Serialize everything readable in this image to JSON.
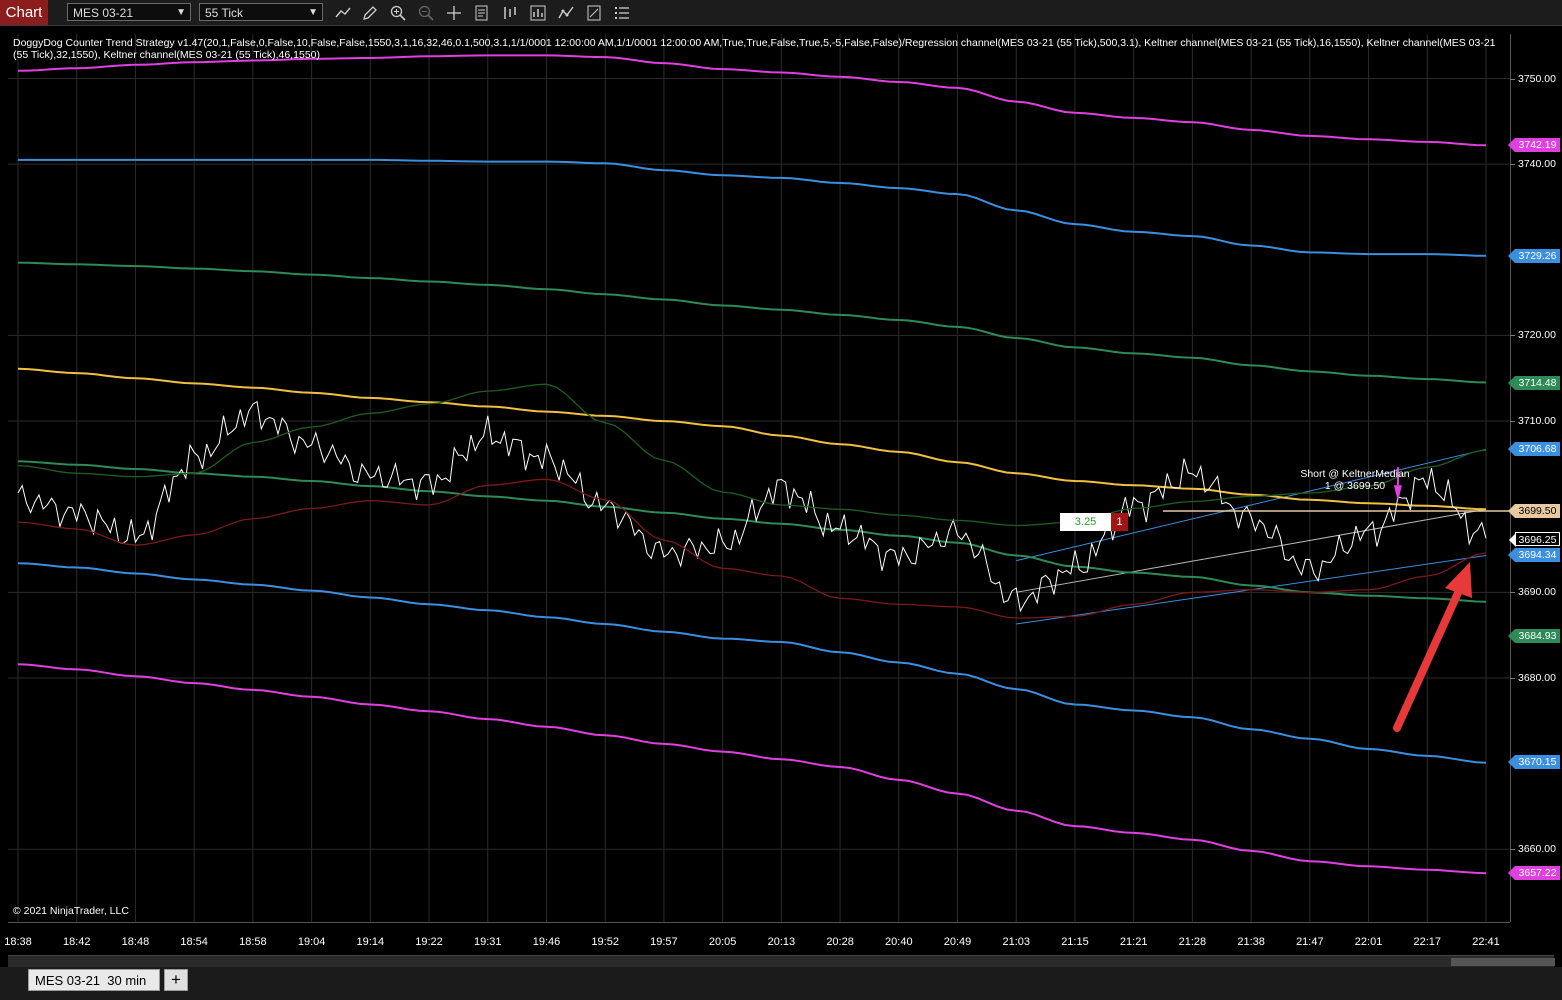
{
  "toolbar": {
    "chart_tab": "Chart",
    "instrument": "MES 03-21",
    "interval": "55 Tick",
    "icons": [
      "line-chart-icon",
      "pencil-icon",
      "zoom-in-icon",
      "zoom-out-icon",
      "crosshair-icon",
      "properties-icon",
      "data-series-icon",
      "indicators-icon",
      "strategies-icon",
      "templates-icon",
      "list-icon"
    ]
  },
  "legend": "DoggyDog Counter Trend Strategy v1.47(20,1,False,0,False,10,False,False,1550,3,1,16,32,46,0.1,500,3.1,1/1/0001 12:00:00 AM,1/1/0001 12:00:00 AM,True,True,False,True,5,-5,False,False)/Regression channel(MES 03-21 (55 Tick),500,3.1), Keltner channel(MES 03-21 (55 Tick),16,1550), Keltner channel(MES 03-21 (55 Tick),32,1550), Keltner channel(MES 03-21 (55 Tick),46,1550)",
  "copyright": "© 2021 NinjaTrader, LLC",
  "x_ticks": [
    "18:38",
    "18:42",
    "18:48",
    "18:54",
    "18:58",
    "19:04",
    "19:14",
    "19:22",
    "19:31",
    "19:46",
    "19:52",
    "19:57",
    "20:05",
    "20:13",
    "20:28",
    "20:40",
    "20:49",
    "21:03",
    "21:15",
    "21:21",
    "21:28",
    "21:38",
    "21:47",
    "22:01",
    "22:17",
    "22:41"
  ],
  "y_ticks": [
    "3750.00",
    "3740.00",
    "3720.00",
    "3710.00",
    "3690.00",
    "3680.00",
    "3660.00"
  ],
  "price_labels": [
    {
      "value": "3742.19",
      "color": "#e040e0"
    },
    {
      "value": "3729.26",
      "color": "#3a8fe0"
    },
    {
      "value": "3714.48",
      "color": "#2e8b57"
    },
    {
      "value": "3706.68",
      "color": "#3a8fe0"
    },
    {
      "value": "3699.50",
      "color": "#e8c9a0"
    },
    {
      "value": "3696.25",
      "color": "#000000"
    },
    {
      "value": "3694.34",
      "color": "#3a8fe0"
    },
    {
      "value": "3684.93",
      "color": "#2e8b57"
    },
    {
      "value": "3670.15",
      "color": "#3a8fe0"
    },
    {
      "value": "3657.22",
      "color": "#e040e0"
    }
  ],
  "trade": {
    "pnl": "3.25",
    "qty": "1",
    "label_line1": "Short @ KeltnerMedian",
    "label_line2": "1 @ 3699.50"
  },
  "bottom": {
    "tab": "MES 03-21  30 min",
    "add": "+"
  },
  "chart_data": {
    "type": "line",
    "title": "",
    "x": [
      "18:38",
      "18:42",
      "18:48",
      "18:54",
      "18:58",
      "19:04",
      "19:14",
      "19:22",
      "19:31",
      "19:46",
      "19:52",
      "19:57",
      "20:05",
      "20:13",
      "20:28",
      "20:40",
      "20:49",
      "21:03",
      "21:15",
      "21:21",
      "21:28",
      "21:38",
      "21:47",
      "22:01",
      "22:17",
      "22:41"
    ],
    "ylim": [
      3651.5,
      3755.2
    ],
    "series": [
      {
        "role": "outer-upper",
        "color": "#e040e0",
        "values": [
          3750.9,
          3751.2,
          3751.6,
          3751.9,
          3752.1,
          3752.3,
          3752.4,
          3752.6,
          3752.7,
          3752.7,
          3752.5,
          3751.8,
          3751.1,
          3750.7,
          3750.2,
          3749.6,
          3748.9,
          3747.3,
          3746.0,
          3745.4,
          3744.9,
          3744.0,
          3743.3,
          3742.9,
          3742.6,
          3742.2
        ]
      },
      {
        "role": "mid-upper",
        "color": "#3a8fe0",
        "values": [
          3740.5,
          3740.5,
          3740.5,
          3740.5,
          3740.5,
          3740.5,
          3740.5,
          3740.4,
          3740.3,
          3740.3,
          3740.1,
          3739.3,
          3738.7,
          3738.4,
          3737.8,
          3737.2,
          3736.5,
          3734.6,
          3733.0,
          3732.1,
          3731.6,
          3730.5,
          3729.7,
          3729.5,
          3729.5,
          3729.3
        ]
      },
      {
        "role": "inner-upper",
        "color": "#2e8b57",
        "values": [
          3728.5,
          3728.3,
          3728.1,
          3727.8,
          3727.5,
          3727.1,
          3726.7,
          3726.3,
          3725.9,
          3725.4,
          3724.8,
          3724.2,
          3723.5,
          3723.0,
          3722.4,
          3721.8,
          3721.0,
          3719.7,
          3718.6,
          3717.9,
          3717.4,
          3716.5,
          3715.8,
          3715.3,
          3714.9,
          3714.5
        ]
      },
      {
        "role": "regression-mid",
        "color": "#f0c040",
        "values": [
          3716.1,
          3715.6,
          3715.0,
          3714.4,
          3713.9,
          3713.3,
          3712.7,
          3712.2,
          3711.7,
          3711.1,
          3710.6,
          3710.0,
          3709.4,
          3708.3,
          3707.3,
          3706.4,
          3705.2,
          3703.9,
          3703.0,
          3702.5,
          3702.1,
          3701.4,
          3700.8,
          3700.4,
          3700.1,
          3699.7
        ]
      },
      {
        "role": "inner-lower",
        "color": "#2e8b57",
        "values": [
          3705.3,
          3704.9,
          3704.4,
          3703.9,
          3703.5,
          3703.0,
          3702.4,
          3701.8,
          3701.2,
          3700.7,
          3700.0,
          3699.3,
          3698.6,
          3698.0,
          3697.3,
          3696.6,
          3695.8,
          3694.3,
          3693.0,
          3692.3,
          3691.8,
          3690.8,
          3690.0,
          3689.6,
          3689.3,
          3688.9
        ]
      },
      {
        "role": "mid-lower",
        "color": "#3a8fe0",
        "values": [
          3693.4,
          3692.9,
          3692.2,
          3691.5,
          3690.9,
          3690.2,
          3689.4,
          3688.6,
          3687.9,
          3687.1,
          3686.3,
          3685.4,
          3684.6,
          3684.2,
          3683.0,
          3681.8,
          3680.5,
          3678.7,
          3676.9,
          3676.2,
          3675.4,
          3674.0,
          3672.9,
          3671.7,
          3670.9,
          3670.1
        ]
      },
      {
        "role": "outer-lower",
        "color": "#e040e0",
        "values": [
          3681.6,
          3681.0,
          3680.2,
          3679.4,
          3678.6,
          3677.8,
          3676.9,
          3676.1,
          3675.2,
          3674.3,
          3673.3,
          3672.3,
          3671.4,
          3670.5,
          3669.6,
          3668.1,
          3666.5,
          3664.5,
          3662.7,
          3661.9,
          3661.1,
          3659.8,
          3658.6,
          3658.0,
          3657.6,
          3657.2
        ]
      },
      {
        "role": "price",
        "color": "#ffffff",
        "values": [
          3701.0,
          3699.2,
          3696.4,
          3705.6,
          3711.0,
          3707.2,
          3703.6,
          3702.7,
          3708.3,
          3705.5,
          3700.0,
          3694.6,
          3695.5,
          3702.2,
          3697.3,
          3694.1,
          3696.9,
          3689.0,
          3692.8,
          3700.1,
          3703.9,
          3698.5,
          3692.6,
          3697.0,
          3703.0,
          3696.3
        ]
      },
      {
        "role": "ma-dark-green",
        "color": "#1f5e1f",
        "values": [
          3704.8,
          3703.9,
          3703.5,
          3703.9,
          3707.5,
          3709.3,
          3710.9,
          3712.0,
          3713.5,
          3714.3,
          3709.8,
          3705.4,
          3701.7,
          3700.2,
          3699.7,
          3699.0,
          3698.4,
          3697.8,
          3698.2,
          3699.8,
          3700.6,
          3701.2,
          3701.6,
          3702.4,
          3704.6,
          3706.6
        ]
      },
      {
        "role": "ma-dark-red",
        "color": "#7a1a1a",
        "values": [
          3698.2,
          3697.4,
          3695.5,
          3696.7,
          3698.6,
          3699.8,
          3700.7,
          3700.2,
          3702.5,
          3703.2,
          3700.8,
          3696.1,
          3692.8,
          3691.9,
          3689.3,
          3688.6,
          3688.3,
          3687.0,
          3687.2,
          3688.6,
          3690.0,
          3690.3,
          3690.0,
          3690.3,
          3691.9,
          3694.6
        ]
      }
    ]
  }
}
